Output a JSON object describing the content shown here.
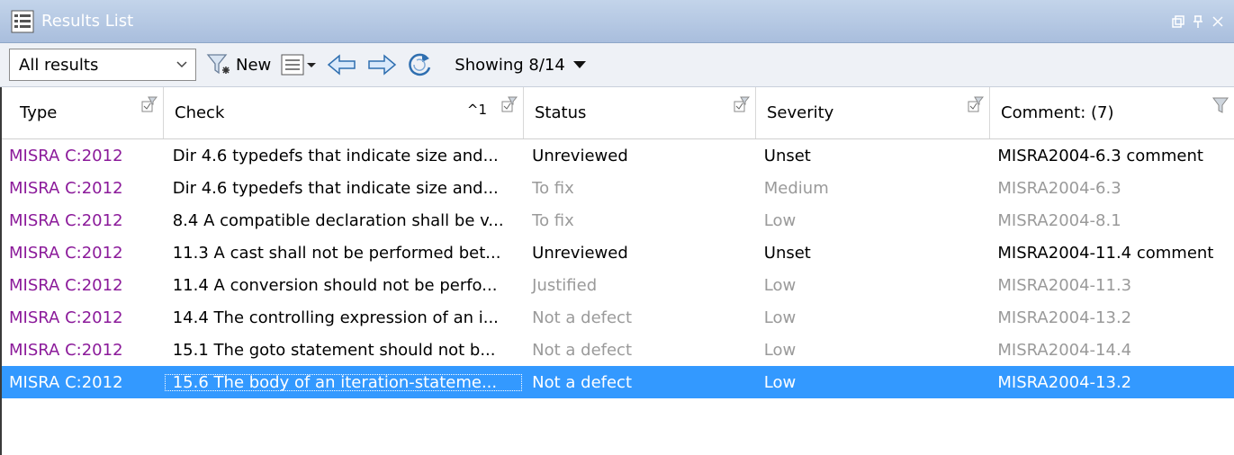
{
  "title": "Results List",
  "toolbar": {
    "filter_value": "All results",
    "new_label": "New",
    "showing": "Showing 8/14"
  },
  "columns": {
    "type": "Type",
    "check": "Check",
    "check_sort": "^1",
    "status": "Status",
    "severity": "Severity",
    "comment": "Comment: (7)"
  },
  "rows": [
    {
      "type": "MISRA C:2012",
      "check": "Dir 4.6 typedefs that indicate size and...",
      "status": "Unreviewed",
      "severity": "Unset",
      "comment": "MISRA2004-6.3 comment"
    },
    {
      "type": "MISRA C:2012",
      "check": "Dir 4.6 typedefs that indicate size and...",
      "status": "To fix",
      "severity": "Medium",
      "comment": "MISRA2004-6.3"
    },
    {
      "type": "MISRA C:2012",
      "check": "8.4 A compatible declaration shall be v...",
      "status": "To fix",
      "severity": "Low",
      "comment": "MISRA2004-8.1"
    },
    {
      "type": "MISRA C:2012",
      "check": "11.3 A cast shall not be performed bet...",
      "status": "Unreviewed",
      "severity": "Unset",
      "comment": "MISRA2004-11.4 comment"
    },
    {
      "type": "MISRA C:2012",
      "check": "11.4 A conversion should not be perfo...",
      "status": "Justified",
      "severity": "Low",
      "comment": "MISRA2004-11.3"
    },
    {
      "type": "MISRA C:2012",
      "check": "14.4 The controlling expression of an i...",
      "status": "Not a defect",
      "severity": "Low",
      "comment": "MISRA2004-13.2"
    },
    {
      "type": "MISRA C:2012",
      "check": "15.1 The goto statement should not b...",
      "status": "Not a defect",
      "severity": "Low",
      "comment": "MISRA2004-14.4"
    },
    {
      "type": "MISRA C:2012",
      "check": "15.6 The body of an iteration-stateme...",
      "status": "Not a defect",
      "severity": "Low",
      "comment": "MISRA2004-13.2"
    }
  ],
  "colors": {
    "type_text": "#8b1a9a",
    "selection": "#3399ff",
    "dim_text": "#9a9a9a"
  }
}
